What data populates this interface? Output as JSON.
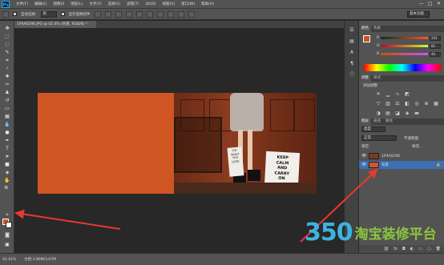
{
  "app": {
    "logo": "Ps"
  },
  "menubar": {
    "items": [
      "文件(F)",
      "编辑(E)",
      "图像(I)",
      "图层(L)",
      "文字(Y)",
      "选择(S)",
      "滤镜(T)",
      "3D(D)",
      "视图(V)",
      "窗口(W)",
      "帮助(H)"
    ],
    "window_controls": [
      "—",
      "□",
      "✕"
    ]
  },
  "options_bar": {
    "auto_select_label": "自动选择:",
    "auto_select_value": "组",
    "show_transform_label": "显示变换控件",
    "workspace_value": "基本功能"
  },
  "document": {
    "tab_label": "1P4A0296.JPG @ 42.4% (背景, RGB/8) *",
    "photo_pillow_text": [
      "KEEP",
      "CALM",
      "AND",
      "CARRY",
      "ON"
    ],
    "photo_small_pillow_text": [
      "DO",
      "WHAT",
      "YOU",
      "LOVE"
    ]
  },
  "status_bar": {
    "zoom": "42.41%",
    "doc_info": "文档:3.86M/3.67M"
  },
  "color_panel": {
    "tabs": [
      "颜色",
      "色板"
    ],
    "channels": [
      {
        "label": "R",
        "value": "202"
      },
      {
        "label": "G",
        "value": "82"
      },
      {
        "label": "B",
        "value": "40"
      }
    ],
    "foreground_color": "#ca5228"
  },
  "adjustments_panel": {
    "tabs": [
      "调整",
      "样式"
    ],
    "title": "添加调整"
  },
  "layers_panel": {
    "tabs": [
      "图层",
      "通道",
      "路径"
    ],
    "filter_label": "类型",
    "blend_mode": "正常",
    "opacity_label": "不透明度:",
    "fill_label": "填充:",
    "lock_label": "锁定:",
    "layers": [
      {
        "name": "1P4A0296",
        "selected": false
      },
      {
        "name": "背景",
        "selected": true
      }
    ]
  },
  "watermark": {
    "number": "350",
    "text": "淘宝装修平台"
  },
  "colors": {
    "accent_orange": "#cf5623",
    "arrow_red": "#e8392f",
    "selection_blue": "#3c6fb4"
  }
}
